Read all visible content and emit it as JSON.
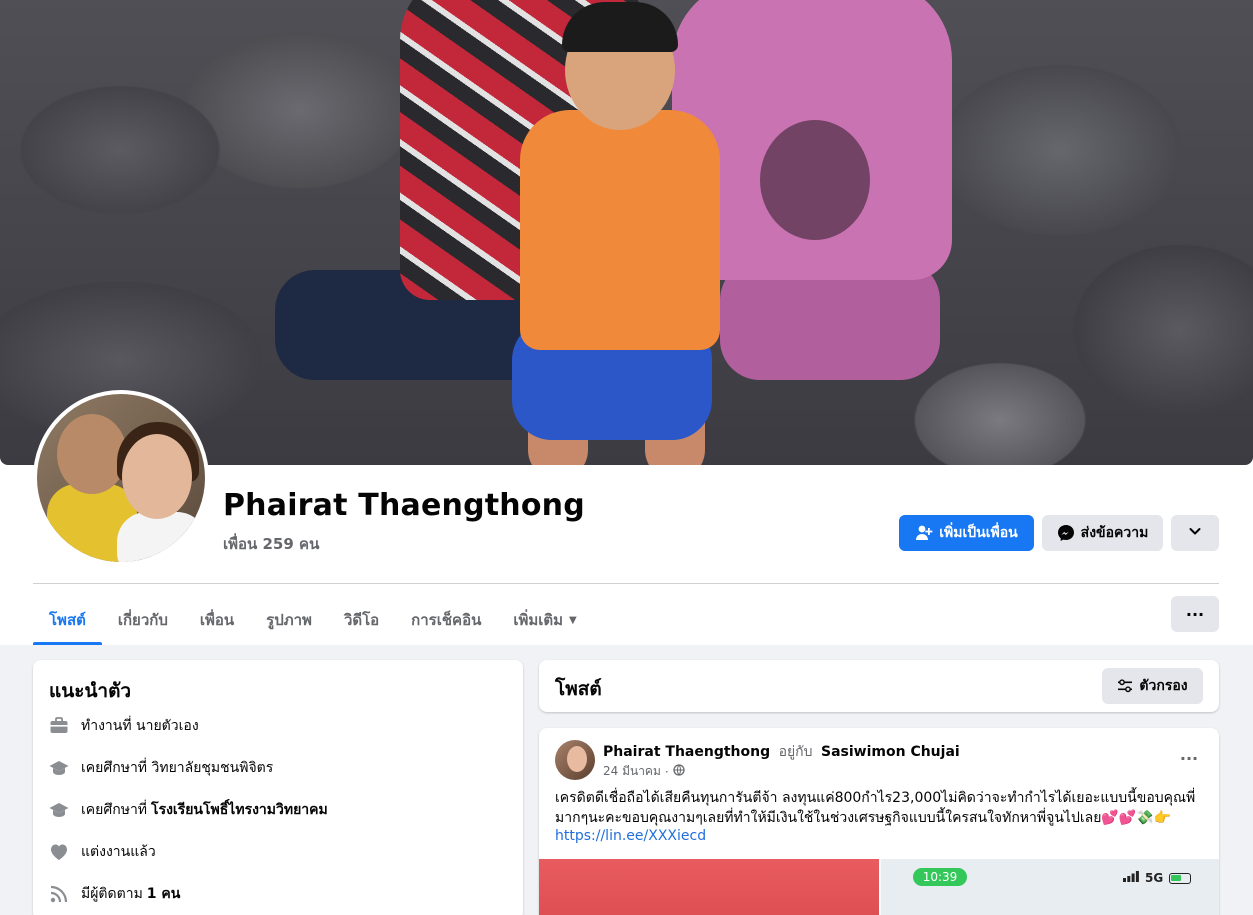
{
  "profile": {
    "name": "Phairat Thaengthong",
    "friends_count": "เพื่อน 259 คน"
  },
  "actions": {
    "add_friend": "เพิ่มเป็นเพื่อน",
    "message": "ส่งข้อความ"
  },
  "tabs": [
    {
      "label": "โพสต์",
      "active": true
    },
    {
      "label": "เกี่ยวกับ"
    },
    {
      "label": "เพื่อน"
    },
    {
      "label": "รูปภาพ"
    },
    {
      "label": "วิดีโอ"
    },
    {
      "label": "การเช็คอิน"
    },
    {
      "label": "เพิ่มเติม"
    }
  ],
  "intro": {
    "title": "แนะนำตัว",
    "items": [
      {
        "icon": "briefcase-icon",
        "text": "ทำงานที่ นายตัวเอง",
        "bold": ""
      },
      {
        "icon": "graduation-cap-icon",
        "text": "เคยศึกษาที่ วิทยาลัยชุมชนพิจิตร",
        "bold": ""
      },
      {
        "icon": "graduation-cap-icon",
        "text": "เคยศึกษาที่",
        "bold": "โรงเรียนโพธิ์ไทรงามวิทยาคม"
      },
      {
        "icon": "heart-icon",
        "text": "แต่งงานแล้ว",
        "bold": ""
      },
      {
        "icon": "rss-icon",
        "text": "มีผู้ติดตาม",
        "bold": "1 คน"
      }
    ]
  },
  "posts": {
    "title": "โพสต์",
    "filter_label": "ตัวกรอง",
    "items": [
      {
        "author": "Phairat Thaengthong",
        "with_word": "อยู่กับ",
        "with_person": "Sasiwimon Chujai",
        "date": "24 มีนาคม",
        "privacy_icon": "globe-icon",
        "text": "เครดิตดีเชื่อถือได้เสียคืนทุนการันตีจ้า ลงทุนแค่800กำไร23,000ไม่คิดว่าจะทำกำไรได้เยอะแบบนี้ขอบคุณพี่มากๆนะคะขอบคุณงามๆเลยที่ทำให้มีเงินใช้ในช่วงเศรษฐกิจแบบนี้ใครสนใจทักหาพี่จูนไปเลย💕💕💸👉",
        "link": "https://lin.ee/XXXiecd",
        "image_phone_time": "10:39",
        "image_phone_network": "5G"
      }
    ]
  },
  "colors": {
    "primary": "#1877f2",
    "secondary_bg": "#e4e6eb",
    "page_bg": "#f0f2f5",
    "muted_text": "#65676b"
  }
}
